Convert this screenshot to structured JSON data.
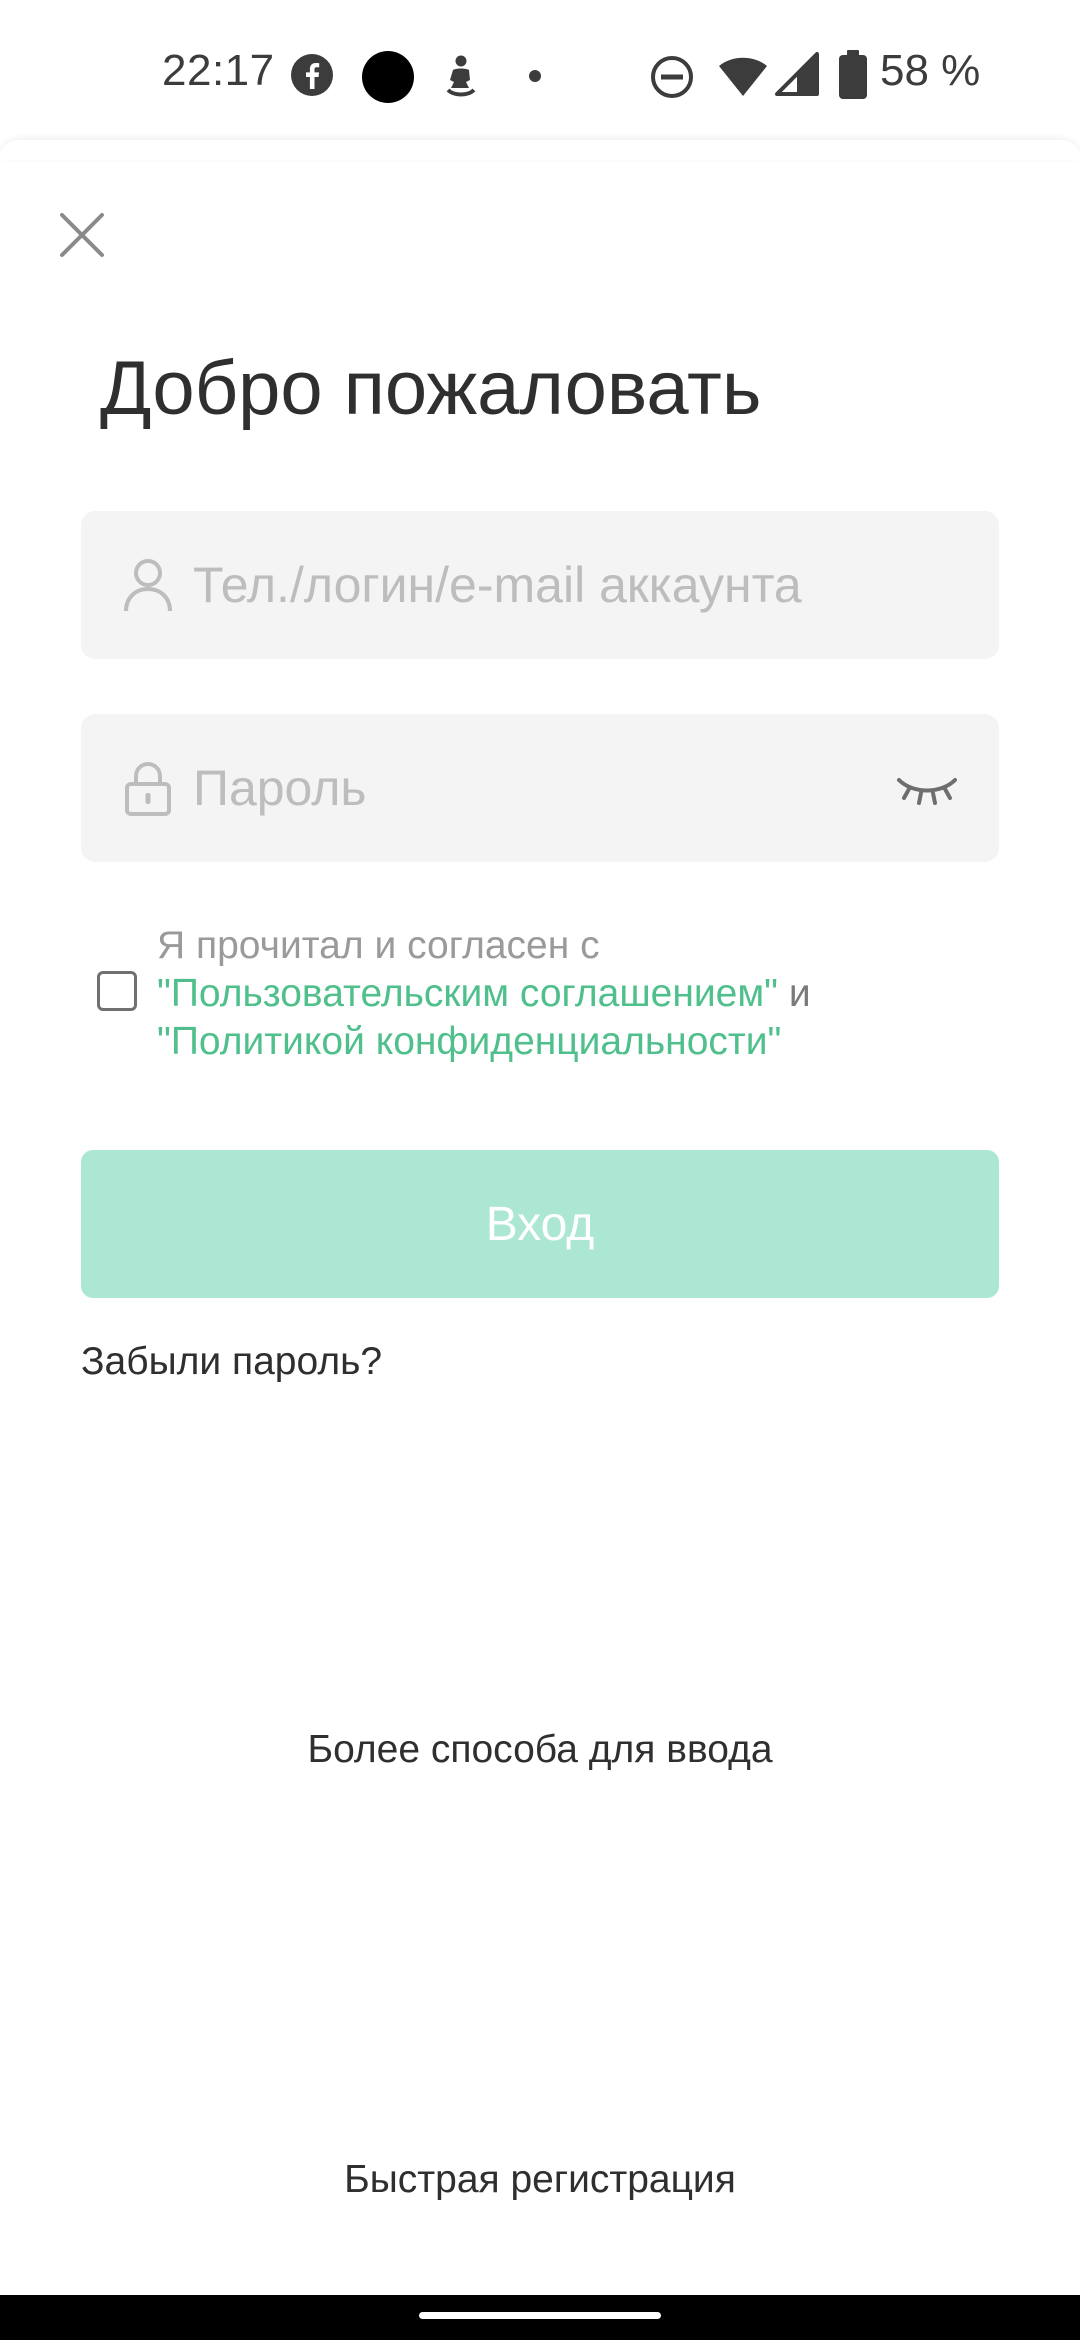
{
  "status_bar": {
    "time": "22:17",
    "battery_text": "58 %",
    "icons": [
      "facebook-icon",
      "circle-notification-icon",
      "figure-notification-icon",
      "dot-icon",
      "do-not-disturb-icon",
      "wifi-icon",
      "signal-icon",
      "battery-icon"
    ]
  },
  "header": {
    "close_icon": "close-icon",
    "title": "Добро пожаловать"
  },
  "form": {
    "username": {
      "placeholder": "Тел./логин/e-mail аккаунта",
      "value": "",
      "icon": "user-icon"
    },
    "password": {
      "placeholder": "Пароль",
      "value": "",
      "icon": "lock-icon",
      "toggle_icon": "eye-closed-icon"
    },
    "agreement": {
      "checked": false,
      "prefix": "Я прочитал и согласен с",
      "user_agreement_link": "\"Пользовательским соглашением\"",
      "conjunction": "и",
      "privacy_link": "\"Политикой конфиденциальности\""
    },
    "login_label": "Вход",
    "forgot_password": "Забыли пароль?"
  },
  "footer": {
    "more_methods": "Более способа для ввода",
    "quick_register": "Быстрая регистрация"
  },
  "colors": {
    "accent_link": "#4fbf8b",
    "login_button_disabled": "#abe7d2",
    "field_background": "#f4f4f4"
  }
}
